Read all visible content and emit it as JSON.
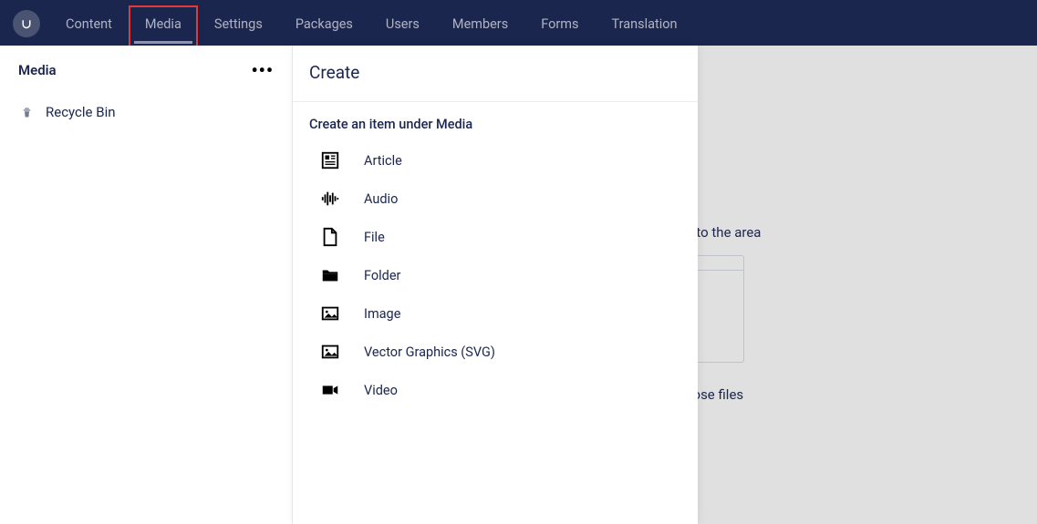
{
  "nav": {
    "items": [
      "Content",
      "Media",
      "Settings",
      "Packages",
      "Users",
      "Members",
      "Forms",
      "Translation"
    ],
    "highlighted": "Media"
  },
  "sidebar": {
    "title": "Media",
    "tree": [
      {
        "icon": "trash-icon",
        "label": "Recycle Bin"
      }
    ]
  },
  "create_panel": {
    "title": "Create",
    "subtitle": "Create an item under Media",
    "items": [
      {
        "icon": "article-icon",
        "label": "Article"
      },
      {
        "icon": "audio-icon",
        "label": "Audio"
      },
      {
        "icon": "file-icon",
        "label": "File"
      },
      {
        "icon": "folder-icon",
        "label": "Folder"
      },
      {
        "icon": "image-icon",
        "label": "Image"
      },
      {
        "icon": "svg-icon",
        "label": "Vector Graphics (SVG)"
      },
      {
        "icon": "video-icon",
        "label": "Video"
      }
    ]
  },
  "dropzone": {
    "intro_suffix": "nd drop your file(s) into the area",
    "click_prefix": "r click here to choose files"
  }
}
